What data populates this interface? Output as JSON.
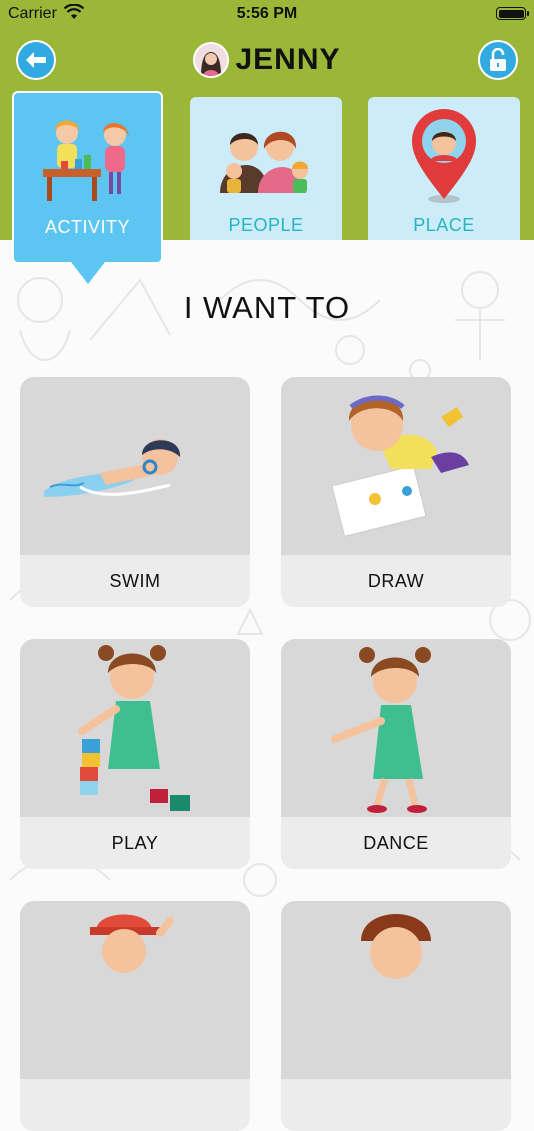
{
  "status_bar": {
    "carrier": "Carrier",
    "time": "5:56 PM"
  },
  "header": {
    "username": "JENNY"
  },
  "tabs": [
    {
      "label": "ACTIVITY",
      "active": true
    },
    {
      "label": "PEOPLE",
      "active": false
    },
    {
      "label": "PLACE",
      "active": false
    }
  ],
  "main": {
    "title": "I WANT TO",
    "cards": [
      {
        "label": "SWIM"
      },
      {
        "label": "DRAW"
      },
      {
        "label": "PLAY"
      },
      {
        "label": "DANCE"
      },
      {
        "label": ""
      },
      {
        "label": ""
      }
    ]
  },
  "colors": {
    "header": "#9bb738",
    "accent": "#31a9e1",
    "active_tab": "#5cc5f2",
    "tab": "#ccecf9",
    "tab_label": "#27b6bd"
  },
  "icons": [
    "wifi-icon",
    "battery-icon",
    "back-arrow-icon",
    "unlock-icon",
    "activity-icon",
    "people-icon",
    "place-pin-icon"
  ]
}
